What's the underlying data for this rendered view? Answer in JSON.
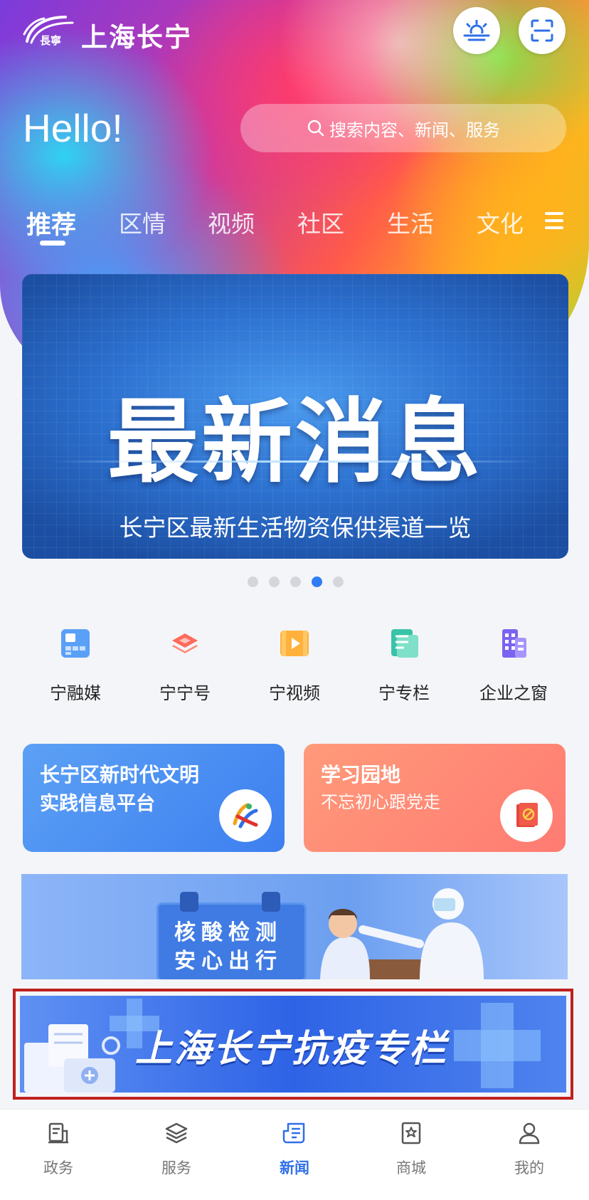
{
  "header": {
    "app_title": "上海长宁",
    "logo_text": "長寧",
    "weather_icon": "weather-icon",
    "scan_icon": "scan-icon"
  },
  "greeting": "Hello!",
  "search": {
    "placeholder": "搜索内容、新闻、服务"
  },
  "tabs": [
    {
      "label": "推荐",
      "active": true
    },
    {
      "label": "区情"
    },
    {
      "label": "视频"
    },
    {
      "label": "社区"
    },
    {
      "label": "生活"
    },
    {
      "label": "文化"
    }
  ],
  "banner": {
    "title": "最新消息",
    "subtitle": "长宁区最新生活物资保供渠道一览",
    "active_index": 3,
    "count": 5
  },
  "quick_links": [
    {
      "label": "宁融媒",
      "icon": "media-icon"
    },
    {
      "label": "宁宁号",
      "icon": "layers-icon"
    },
    {
      "label": "宁视频",
      "icon": "video-icon"
    },
    {
      "label": "宁专栏",
      "icon": "column-icon"
    },
    {
      "label": "企业之窗",
      "icon": "building-icon"
    }
  ],
  "cards": [
    {
      "line1": "长宁区新时代文明",
      "line2": "实践信息平台"
    },
    {
      "line1": "学习园地",
      "line2": "不忘初心跟党走"
    }
  ],
  "nat_banner": {
    "line1": "核酸检测",
    "line2": "安心出行"
  },
  "covid_banner": {
    "title": "上海长宁抗疫专栏"
  },
  "tabbar": [
    {
      "label": "政务",
      "icon": "gov-icon"
    },
    {
      "label": "服务",
      "icon": "service-icon"
    },
    {
      "label": "新闻",
      "icon": "news-icon",
      "active": true
    },
    {
      "label": "商城",
      "icon": "mall-icon"
    },
    {
      "label": "我的",
      "icon": "profile-icon"
    }
  ],
  "colors": {
    "accent": "#2f6fe8",
    "highlight_border": "#c0201e"
  }
}
